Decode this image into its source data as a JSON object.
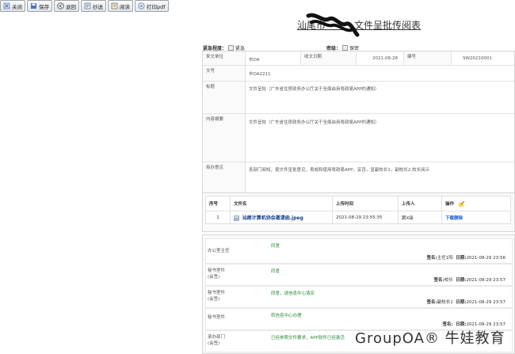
{
  "toolbar": [
    {
      "label": "关闭",
      "icon": "close-doc-icon"
    },
    {
      "label": "保存",
      "icon": "save-icon"
    },
    {
      "label": "退回",
      "icon": "back-icon"
    },
    {
      "label": "抄送",
      "icon": "cc-icon"
    },
    {
      "label": "阅读",
      "icon": "read-icon"
    },
    {
      "label": "打印pdf",
      "icon": "print-icon"
    }
  ],
  "title": "汕尾市　　　文件呈批传阅表",
  "urgency": {
    "label": "紧急程度：",
    "option": "紧急"
  },
  "secret": {
    "label": "密级：",
    "option": "保密"
  },
  "form": {
    "from_label": "来文单位",
    "from_value": "市OA",
    "date_label": "收文日期",
    "date_value": "2021-08-28",
    "no_label": "编号",
    "no_value": "SW20210001",
    "docno_label": "文号",
    "docno_value": "市OA2211",
    "subject_label": "标题",
    "subject_value": "文件呈批（广东省住房政务办公厅关于全面启用粤政易APP的通知）",
    "summary_label": "内容摘要",
    "summary_value": "文件呈批（广东省住房政务办公厅关于全面启用粤政易APP的通知）",
    "proposal_label": "拟办意见",
    "proposal_value": "各部门阅知，按文件呈批意见，责成和使用粤政易APP，妥否，呈副校长1，副校长2,校长阅示"
  },
  "attachments": {
    "headers": [
      "序号",
      "文件名",
      "上传时间",
      "上传人",
      "操作"
    ],
    "rows": [
      {
        "no": "1",
        "name": "汕尾计算机协会邀请函.jpeg",
        "time": "2021-08-29 23:55:35",
        "user": "跟X级",
        "op": "下载删除"
      }
    ]
  },
  "opinions": [
    {
      "role": "办公室主任",
      "text": "同意",
      "sign_label": "签名:",
      "signer": "主任1阳",
      "date_label": "日期:",
      "date": "2021-08-29 23:56"
    },
    {
      "role": "秘书室件\n(会签)",
      "text": "同意",
      "sign_label": "签名:",
      "signer": "校长",
      "date_label": "日期:",
      "date": "2021-08-29 23:57"
    },
    {
      "role": "秘书室件\n(会签)",
      "text": "同意，请信息中心落实",
      "sign_label": "签名:",
      "signer": "副校长1",
      "date_label": "日期:",
      "date": "2021-08-29 23:57"
    },
    {
      "role": "秘书室件",
      "text": "转信息中心办理",
      "sign_label": "签名:",
      "signer": "",
      "date_label": "日期:",
      "date": "2021-08-29 23:57"
    },
    {
      "role": "承办部门\n(会签)",
      "text": "已经参照文件要求，APP软件已经激活",
      "sign_label": "",
      "signer": "",
      "date_label": "",
      "date": ""
    }
  ],
  "watermark": "GroupOA® 牛娃教育"
}
